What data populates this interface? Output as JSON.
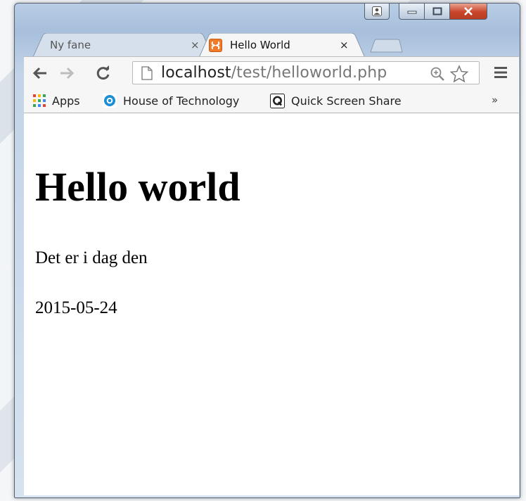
{
  "tabs": [
    {
      "label": "Ny fane",
      "close": "×"
    },
    {
      "label": "Hello World",
      "close": "×"
    }
  ],
  "omnibox": {
    "host": "localhost",
    "path": "/test/helloworld.php"
  },
  "toolbar": {
    "icons": [
      "back-arrow-icon",
      "forward-arrow-icon",
      "reload-icon",
      "page-icon",
      "zoom-icon",
      "star-icon",
      "menu-icon"
    ]
  },
  "bookmarks": [
    {
      "label": "Apps",
      "icon": "apps-grid-icon"
    },
    {
      "label": "House of Technology",
      "icon": "hot-icon"
    },
    {
      "label": "Quick Screen Share",
      "icon": "q-icon"
    }
  ],
  "bookmarks_overflow": "»",
  "page": {
    "heading": "Hello world",
    "line1": "Det er i dag den",
    "line2": "2015-05-24"
  },
  "colors": {
    "favicon": "#f07b2a",
    "close_button": "#c8452b",
    "apps_colors": [
      "#e94235",
      "#fbbc05",
      "#34a853",
      "#4285f4"
    ]
  }
}
